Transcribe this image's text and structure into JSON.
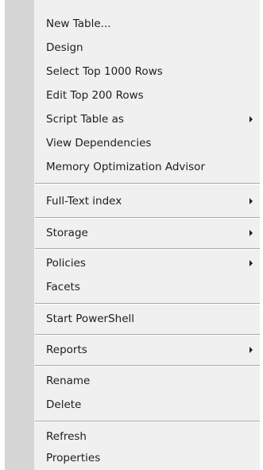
{
  "context_menu": {
    "items": [
      {
        "label": "New Table...",
        "submenu": false
      },
      {
        "label": "Design",
        "submenu": false
      },
      {
        "label": "Select Top 1000 Rows",
        "submenu": false
      },
      {
        "label": "Edit Top 200 Rows",
        "submenu": false
      },
      {
        "label": "Script Table as",
        "submenu": true
      },
      {
        "label": "View Dependencies",
        "submenu": false
      },
      {
        "label": "Memory Optimization Advisor",
        "submenu": false
      },
      {
        "label": "Full-Text index",
        "submenu": true
      },
      {
        "label": "Storage",
        "submenu": true
      },
      {
        "label": "Policies",
        "submenu": true
      },
      {
        "label": "Facets",
        "submenu": false
      },
      {
        "label": "Start PowerShell",
        "submenu": false
      },
      {
        "label": "Reports",
        "submenu": true
      },
      {
        "label": "Rename",
        "submenu": false
      },
      {
        "label": "Delete",
        "submenu": false
      },
      {
        "label": "Refresh",
        "submenu": false
      },
      {
        "label": "Properties",
        "submenu": false
      }
    ],
    "submenu_arrow_icon": "chevron-right-icon"
  }
}
